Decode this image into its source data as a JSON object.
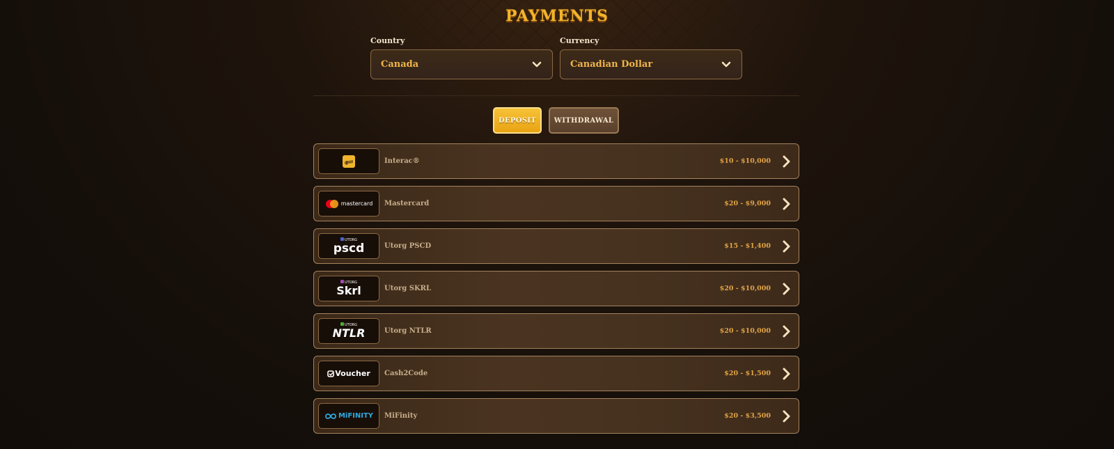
{
  "page": {
    "title": "PAYMENTS"
  },
  "filters": {
    "country": {
      "label": "Country",
      "value": "Canada"
    },
    "currency": {
      "label": "Currency",
      "value": "Canadian Dollar"
    }
  },
  "tabs": {
    "deposit": "DEPOSIT",
    "withdrawal": "WITHDRAWAL",
    "active": "deposit"
  },
  "methods": [
    {
      "name": "Interac®",
      "range": "$10 - $10,000",
      "logo": "interac-logo"
    },
    {
      "name": "Mastercard",
      "range": "$20 - $9,000",
      "logo": "mastercard-logo",
      "logo_text": "mastercard"
    },
    {
      "name": "Utorg PSCD",
      "range": "$15 - $1,400",
      "logo": "utorg-pscd-logo",
      "logo_top": "UTORG",
      "logo_main": "pscd"
    },
    {
      "name": "Utorg SKRL",
      "range": "$20 - $10,000",
      "logo": "utorg-skrl-logo",
      "logo_top": "UTORG",
      "logo_main": "Skrl"
    },
    {
      "name": "Utorg NTLR",
      "range": "$20 - $10,000",
      "logo": "utorg-ntlr-logo",
      "logo_top": "UTORG",
      "logo_main": "NTLR"
    },
    {
      "name": "Cash2Code",
      "range": "$20 - $1,500",
      "logo": "voucher-logo",
      "logo_main": "Voucher"
    },
    {
      "name": "MiFinity",
      "range": "$20 - $3,500",
      "logo": "mifinity-logo",
      "logo_main": "MiFINITY"
    }
  ],
  "colors": {
    "accent": "#f2b42b",
    "range": "#e0a447",
    "card_border": "#a5845e"
  }
}
